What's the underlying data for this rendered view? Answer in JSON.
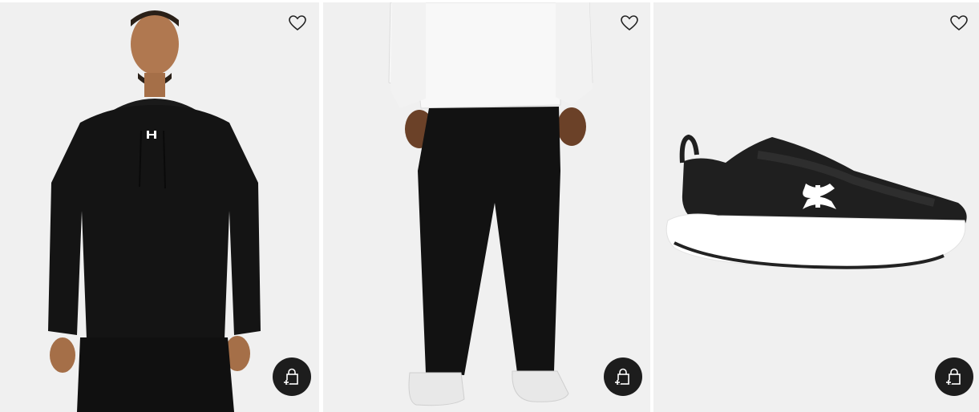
{
  "products": [
    {
      "image_alt": "",
      "wishlist_label": "",
      "quick_add_label": "",
      "icons": {
        "wishlist": "heart-outline-icon",
        "quick_add": "bag-plus-icon"
      },
      "colors": {
        "garment": "#141414",
        "background": "#f0f0f0"
      }
    },
    {
      "image_alt": "",
      "wishlist_label": "",
      "quick_add_label": "",
      "icons": {
        "wishlist": "heart-outline-icon",
        "quick_add": "bag-plus-icon"
      },
      "colors": {
        "garment": "#141414",
        "background": "#f0f0f0"
      }
    },
    {
      "image_alt": "",
      "wishlist_label": "",
      "quick_add_label": "",
      "icons": {
        "wishlist": "heart-outline-icon",
        "quick_add": "bag-plus-icon"
      },
      "colors": {
        "garment": "#1f1f1f",
        "sole": "#ffffff",
        "background": "#f0f0f0"
      }
    }
  ],
  "theme": {
    "button_bg": "#1d1d1d",
    "icon_color": "#222222"
  }
}
